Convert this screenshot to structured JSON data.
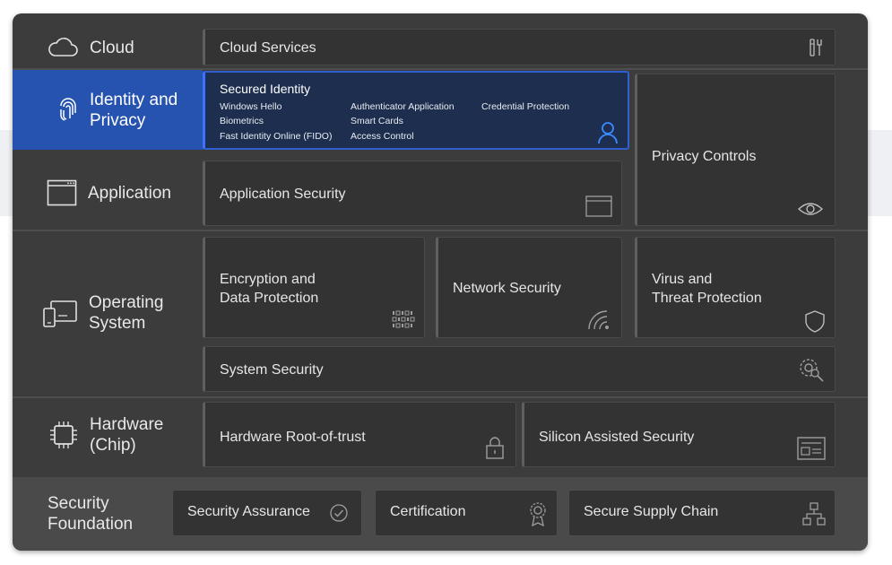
{
  "categories": {
    "cloud": "Cloud",
    "identity": [
      "Identity and",
      "Privacy"
    ],
    "application": "Application",
    "os": [
      "Operating",
      "System"
    ],
    "hardware": [
      "Hardware",
      "(Chip)"
    ],
    "foundation": [
      "Security",
      "Foundation"
    ]
  },
  "tiles": {
    "cloud_services": "Cloud Services",
    "secured_identity": {
      "title": "Secured Identity",
      "col1": [
        "Windows Hello",
        "Biometrics",
        "Fast Identity Online (FIDO)"
      ],
      "col2": [
        "Authenticator Application",
        "Smart Cards",
        "Access Control"
      ],
      "col3": [
        "Credential Protection"
      ]
    },
    "privacy_controls": "Privacy Controls",
    "application_security": "Application Security",
    "encryption": [
      "Encryption and",
      "Data Protection"
    ],
    "network_security": "Network Security",
    "virus": [
      "Virus and",
      "Threat Protection"
    ],
    "system_security": "System Security",
    "hardware_root": "Hardware Root-of-trust",
    "silicon": "Silicon Assisted Security",
    "security_assurance": "Security Assurance",
    "certification": "Certification",
    "supply_chain": "Secure Supply Chain"
  },
  "icons": [
    "cloud-icon",
    "fingerprint-icon",
    "window-icon",
    "devices-icon",
    "chip-icon",
    "tools-icon",
    "person-icon",
    "eye-icon",
    "binary-icon",
    "wifi-icon",
    "shield-icon",
    "gear-search-icon",
    "lock-icon",
    "card-icon",
    "check-circle-icon",
    "certificate-icon",
    "network-tree-icon"
  ],
  "colors": {
    "panel": "#3c3c3c",
    "tile": "#333333",
    "accent": "#2753b0",
    "selected_tile": "#1e2e4e",
    "selected_border": "#2f5fd0"
  }
}
